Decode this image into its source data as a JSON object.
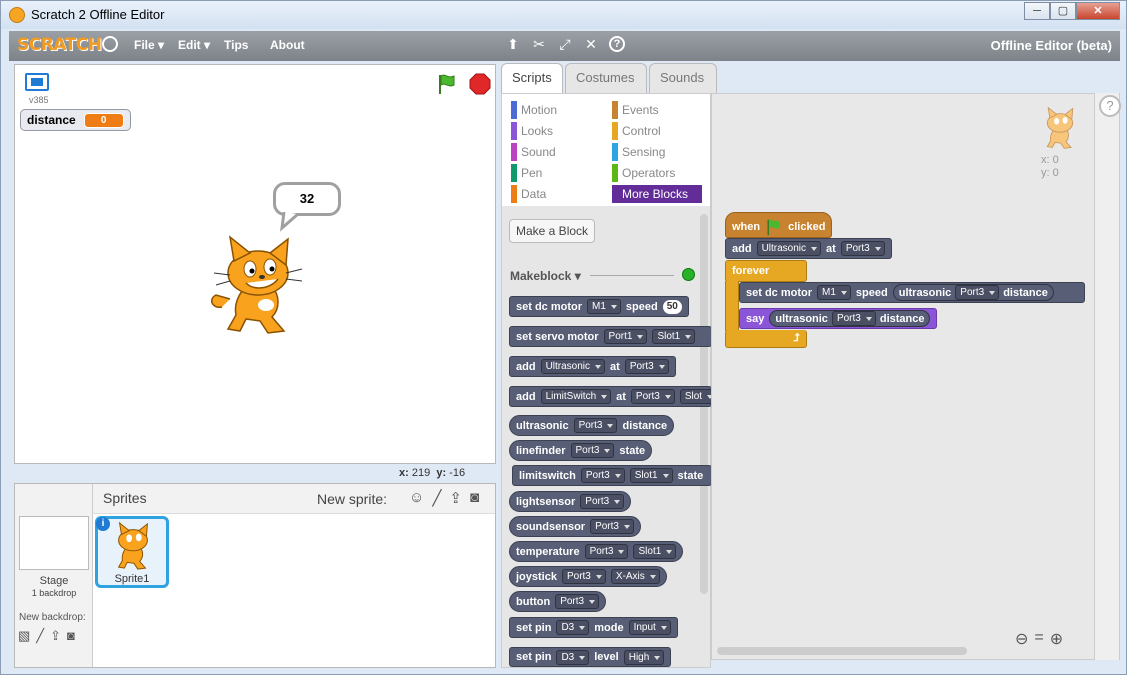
{
  "window": {
    "title": "Scratch 2 Offline Editor",
    "controls": [
      "─",
      "▢",
      "✕"
    ]
  },
  "menu": {
    "logo": "SCRATCH",
    "items": [
      "File ▾",
      "Edit ▾",
      "Tips",
      "About"
    ],
    "editor_title": "Offline Editor (beta)",
    "tool_icons": [
      "duplicate-icon",
      "cut-icon",
      "grow-icon",
      "shrink-icon",
      "help-icon"
    ]
  },
  "stage": {
    "version": "v385",
    "monitor": {
      "label": "distance",
      "value": "0"
    },
    "bubble_text": "32",
    "coords": {
      "x_label": "x:",
      "x_value": "219",
      "y_label": "y:",
      "y_value": "-16"
    }
  },
  "sprites": {
    "header": "Sprites",
    "new_sprite_label": "New sprite:",
    "stage_label": "Stage",
    "stage_sub": "1 backdrop",
    "new_backdrop": "New backdrop:",
    "sprite_name": "Sprite1",
    "info": "i"
  },
  "tabs": [
    "Scripts",
    "Costumes",
    "Sounds"
  ],
  "palette": {
    "categories": [
      {
        "label": "Motion",
        "color": "#4a6cd4"
      },
      {
        "label": "Events",
        "color": "#c88330"
      },
      {
        "label": "Looks",
        "color": "#8a55d7"
      },
      {
        "label": "Control",
        "color": "#e6a822"
      },
      {
        "label": "Sound",
        "color": "#bb42c3"
      },
      {
        "label": "Sensing",
        "color": "#2ca5e2"
      },
      {
        "label": "Pen",
        "color": "#0e9a6c"
      },
      {
        "label": "Operators",
        "color": "#5cb712"
      },
      {
        "label": "Data",
        "color": "#ee7d16"
      },
      {
        "label": "More Blocks",
        "color": "#632d99"
      }
    ],
    "make_block": "Make a Block",
    "extension": "Makeblock ▾",
    "blocks": {
      "b1": {
        "t1": "set dc motor",
        "d1": "M1",
        "t2": "speed",
        "n": "50"
      },
      "b2": {
        "t1": "set servo motor",
        "d1": "Port1",
        "d2": "Slot1"
      },
      "b3": {
        "t1": "add",
        "d1": "Ultrasonic",
        "t2": "at",
        "d2": "Port3"
      },
      "b4": {
        "t1": "add",
        "d1": "LimitSwitch",
        "t2": "at",
        "d2": "Port3",
        "d3": "Slot"
      },
      "b5": {
        "t1": "ultrasonic",
        "d1": "Port3",
        "t2": "distance"
      },
      "b6": {
        "t1": "linefinder",
        "d1": "Port3",
        "t2": "state"
      },
      "b7": {
        "t1": "limitswitch",
        "d1": "Port3",
        "d2": "Slot1",
        "t2": "state"
      },
      "b8": {
        "t1": "lightsensor",
        "d1": "Port3"
      },
      "b9": {
        "t1": "soundsensor",
        "d1": "Port3"
      },
      "b10": {
        "t1": "temperature",
        "d1": "Port3",
        "d2": "Slot1"
      },
      "b11": {
        "t1": "joystick",
        "d1": "Port3",
        "d2": "X-Axis"
      },
      "b12": {
        "t1": "button",
        "d1": "Port3"
      },
      "b13": {
        "t1": "set pin",
        "d1": "D3",
        "t2": "mode",
        "d2": "Input"
      },
      "b14": {
        "t1": "set pin",
        "d1": "D3",
        "t2": "level",
        "d2": "High"
      }
    }
  },
  "script": {
    "hat": {
      "t1": "when",
      "t2": "clicked"
    },
    "add": {
      "t1": "add",
      "d1": "Ultrasonic",
      "t2": "at",
      "d2": "Port3"
    },
    "forever": "forever",
    "motor": {
      "t1": "set dc motor",
      "d1": "M1",
      "t2": "speed",
      "r1": "ultrasonic",
      "r2": "Port3",
      "r3": "distance"
    },
    "say": {
      "t1": "say",
      "r1": "ultrasonic",
      "r2": "Port3",
      "r3": "distance"
    },
    "sprite_xy": {
      "x": "x: 0",
      "y": "y: 0"
    }
  },
  "help": "?"
}
